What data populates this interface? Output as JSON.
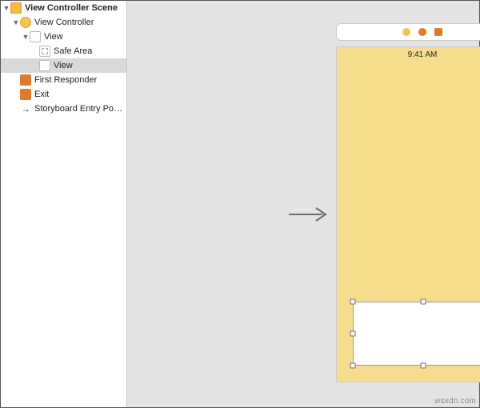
{
  "outline": {
    "scene": "View Controller Scene",
    "view_controller": "View Controller",
    "root_view": "View",
    "safe_area": "Safe Area",
    "selected_view": "View",
    "first_responder": "First Responder",
    "exit": "Exit",
    "entry_point": "Storyboard Entry Poi…"
  },
  "statusbar": {
    "time": "9:41 AM"
  },
  "watermark": "wsxdn.com"
}
